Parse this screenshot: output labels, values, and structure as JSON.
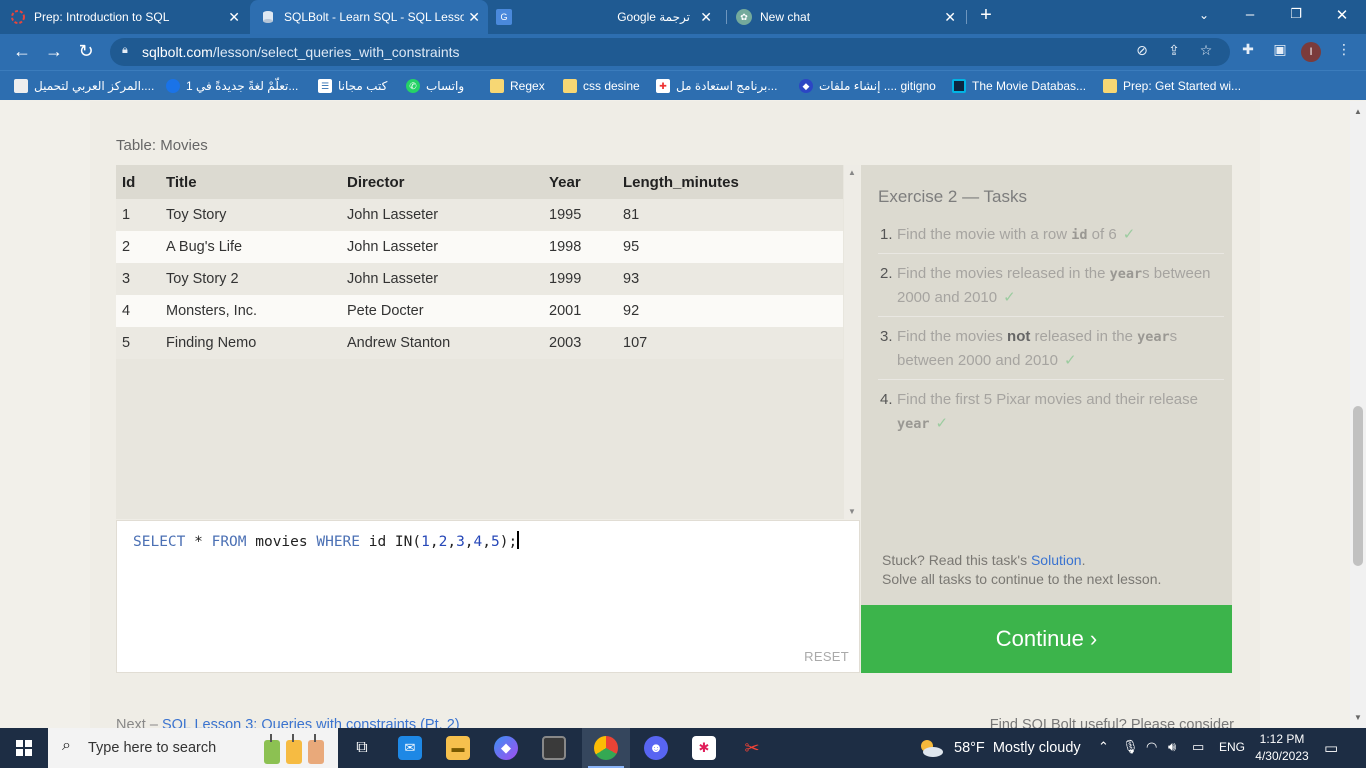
{
  "browser": {
    "tabs": [
      {
        "title": "Prep: Introduction to SQL",
        "icon": "loading-icon"
      },
      {
        "title": "SQLBolt - Learn SQL - SQL Lesson",
        "icon": "sqlbolt-icon"
      },
      {
        "title": "",
        "icon": "google-translate-icon"
      },
      {
        "title": "Google ترجمة",
        "icon": "none"
      },
      {
        "title": "New chat",
        "icon": "chatgpt-icon"
      }
    ],
    "new_tab_label": "+",
    "url_domain": "sqlbolt.com",
    "url_path": "/lesson/select_queries_with_constraints",
    "profile_initial": "I",
    "bookmarks": [
      {
        "label": "المركز العربي لتحميل...."
      },
      {
        "label": "تعلّمْ لغةً جديدةً في 1..."
      },
      {
        "label": "كتب مجانا"
      },
      {
        "label": "واتساب"
      },
      {
        "label": "Regex"
      },
      {
        "label": "css desine"
      },
      {
        "label": "برنامج استعادة مل..."
      },
      {
        "label": "إنشاء ملفات .... gitigno"
      },
      {
        "label": "The Movie Databas..."
      },
      {
        "label": "Prep: Get Started wi..."
      }
    ]
  },
  "lesson": {
    "table_label": "Table: Movies",
    "columns": [
      "Id",
      "Title",
      "Director",
      "Year",
      "Length_minutes"
    ],
    "rows": [
      [
        "1",
        "Toy Story",
        "John Lasseter",
        "1995",
        "81"
      ],
      [
        "2",
        "A Bug's Life",
        "John Lasseter",
        "1998",
        "95"
      ],
      [
        "3",
        "Toy Story 2",
        "John Lasseter",
        "1999",
        "93"
      ],
      [
        "4",
        "Monsters, Inc.",
        "Pete Docter",
        "2001",
        "92"
      ],
      [
        "5",
        "Finding Nemo",
        "Andrew Stanton",
        "2003",
        "107"
      ]
    ],
    "query": {
      "kw_select": "SELECT",
      "star": " * ",
      "kw_from": "FROM",
      "table": " movies ",
      "kw_where": "WHERE",
      "col": " id IN(",
      "n1": "1",
      "n2": "2",
      "n3": "3",
      "n4": "4",
      "n5": "5",
      "comma": ",",
      "end": ");"
    },
    "reset_label": "RESET",
    "exercise_title": "Exercise 2 — Tasks",
    "tasks": [
      {
        "num": "1.",
        "a": "Find the movie with a row ",
        "code": "id",
        "b": " of 6"
      },
      {
        "num": "2.",
        "a": "Find the movies released in the ",
        "code": "year",
        "b": "s between 2000 and 2010"
      },
      {
        "num": "3.",
        "a": "Find the movies ",
        "strong": "not",
        "a2": " released in the ",
        "code": "year",
        "b": "s between 2000 and 2010"
      },
      {
        "num": "4.",
        "a": "Find the first 5 Pixar movies and their release ",
        "code": "year",
        "b": ""
      }
    ],
    "check": "✓",
    "stuck_text": "Stuck? Read this task's ",
    "solution_link": "Solution",
    "stuck_end": ".",
    "solve_text": "Solve all tasks to continue to the next lesson.",
    "continue_label": "Continue ›",
    "next_prefix": "Next – ",
    "next_link": "SQL Lesson 3: Queries with constraints (Pt. 2)",
    "useful_text": "Find SQLBolt useful? Please consider"
  },
  "taskbar": {
    "search_placeholder": "Type here to search",
    "weather": "58°F  Mostly cloudy",
    "lang": "ENG",
    "time": "1:12 PM",
    "date": "4/30/2023"
  }
}
